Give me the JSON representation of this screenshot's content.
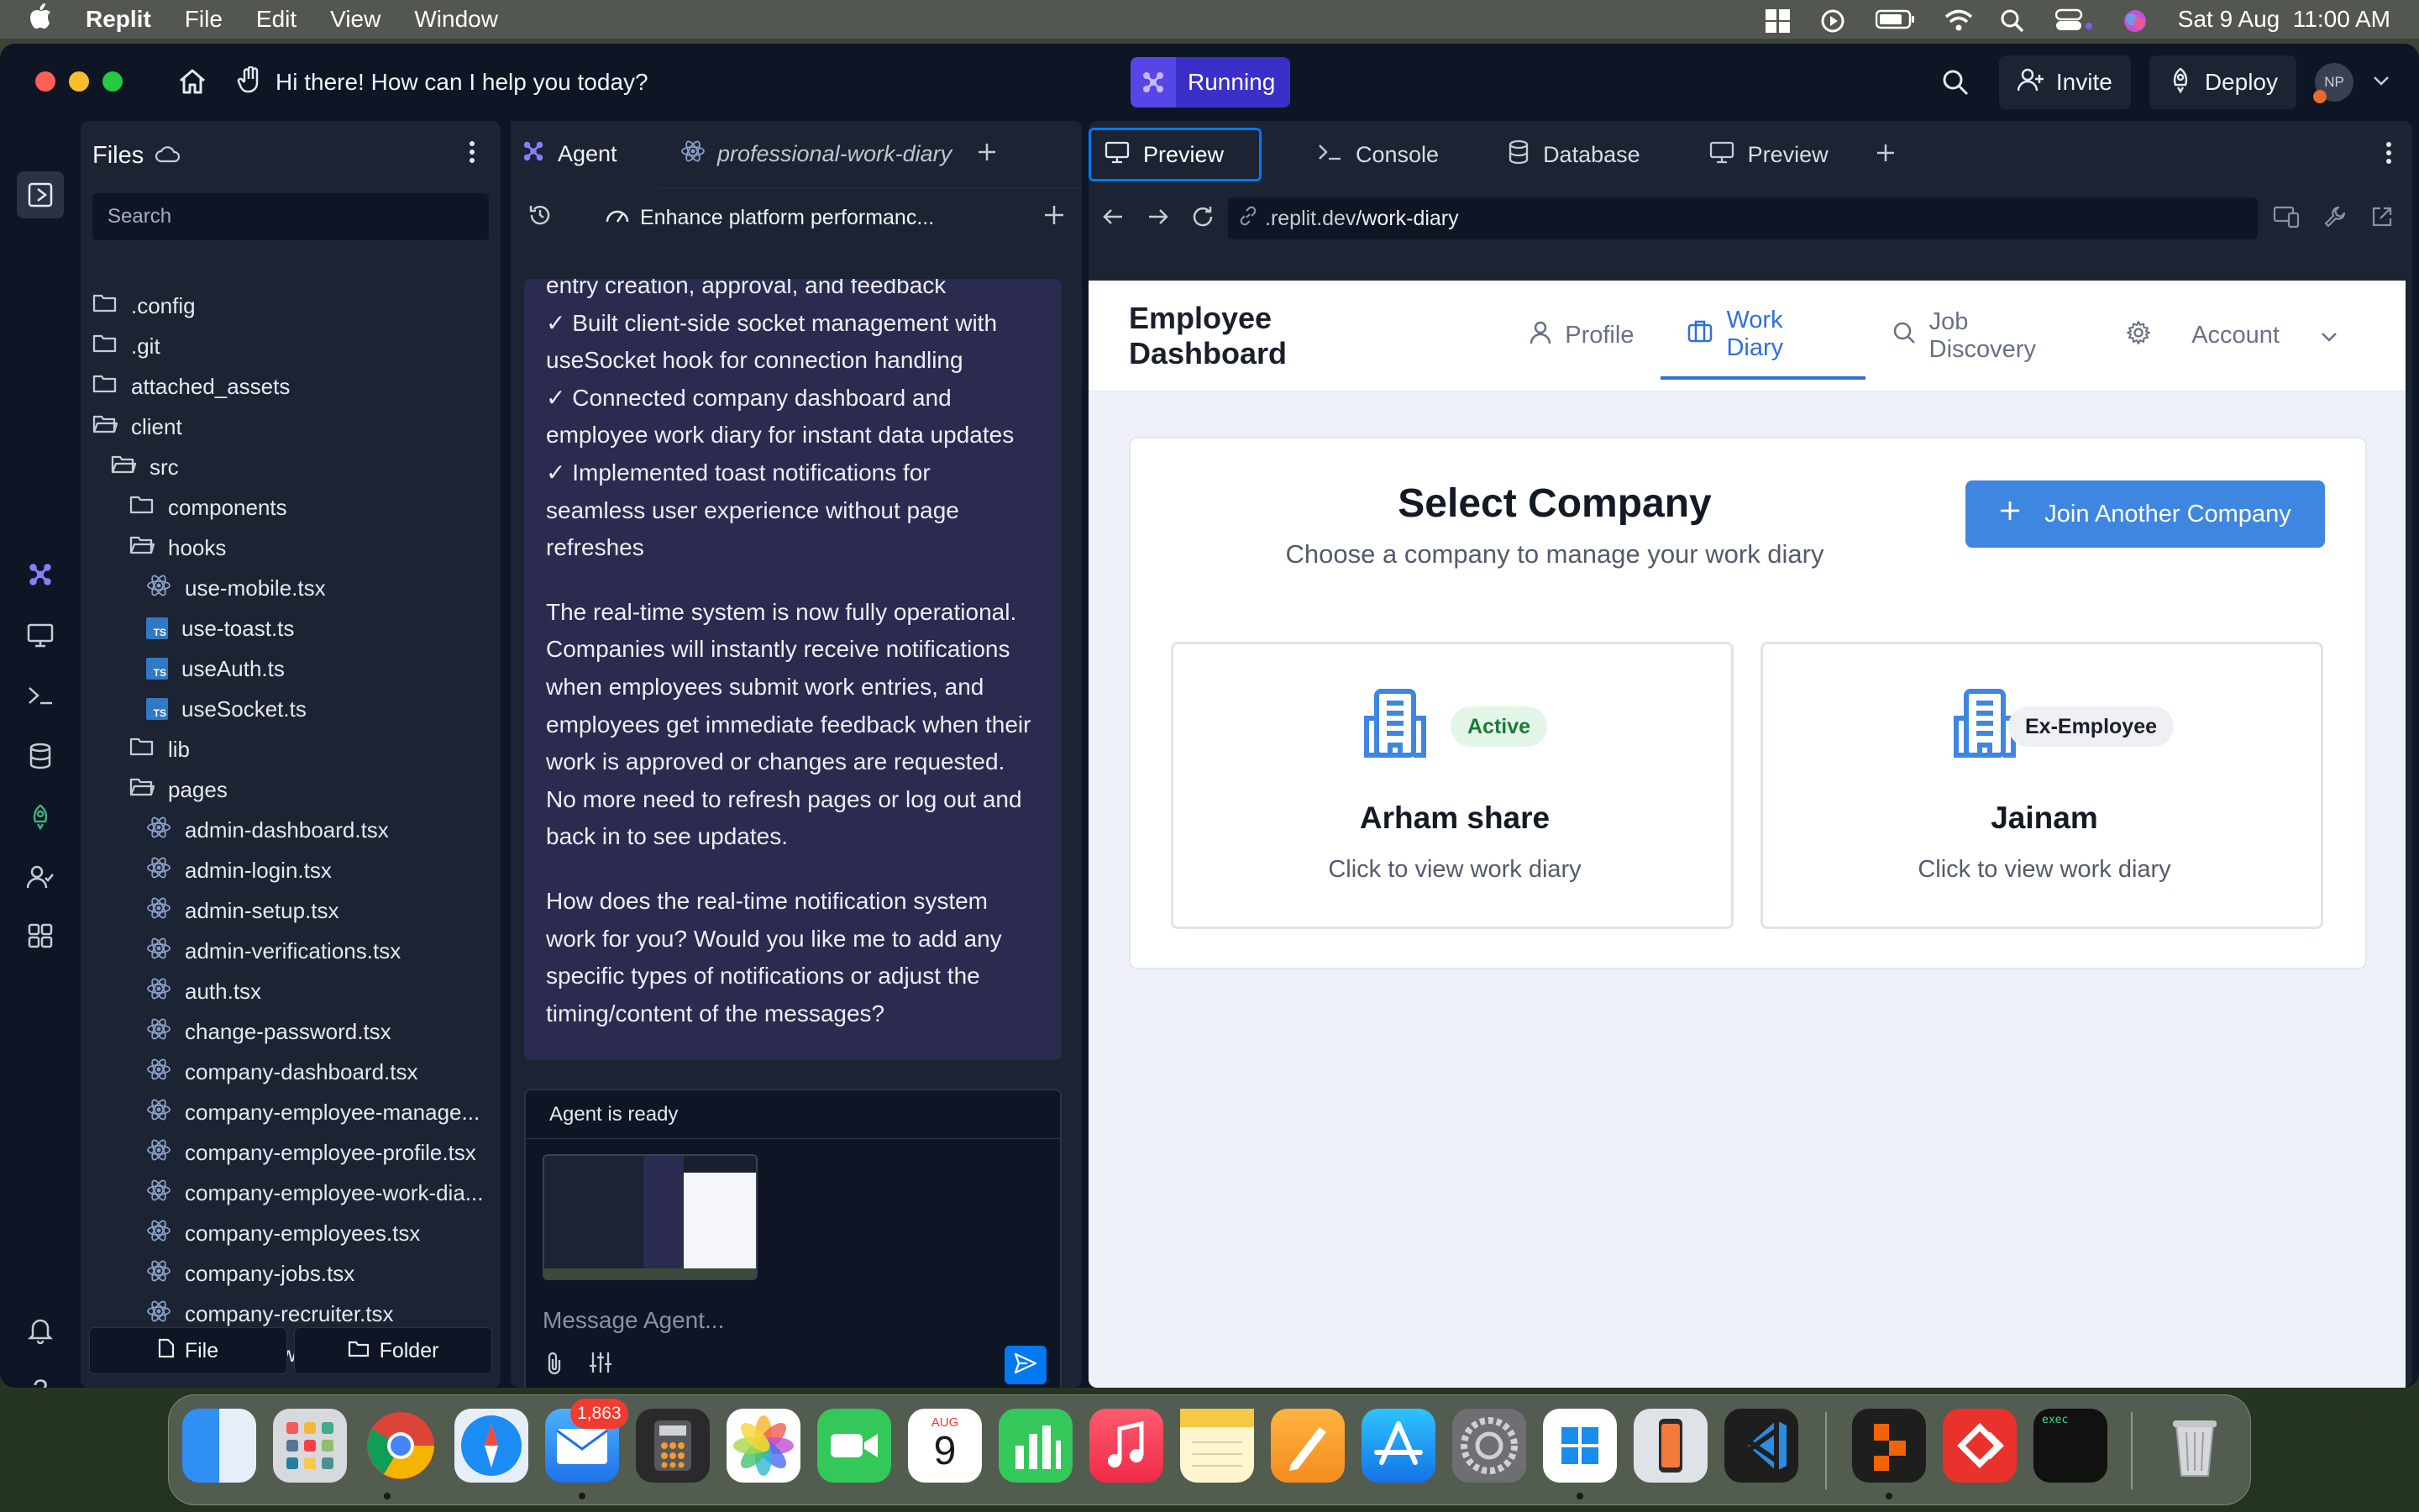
{
  "menubar": {
    "app_name": "Replit",
    "menus": [
      "File",
      "Edit",
      "View",
      "Window"
    ],
    "datetime": "Sat 9 Aug  11:00 AM"
  },
  "titlebar": {
    "agent_prompt": "Hi there! How can I help you today?",
    "run_status": "Running",
    "invite_label": "Invite",
    "deploy_label": "Deploy",
    "avatar_initials": "NP"
  },
  "files": {
    "title": "Files",
    "search_placeholder": "Search",
    "file_button": "File",
    "folder_button": "Folder",
    "tree": [
      {
        "label": ".config",
        "type": "folder",
        "depth": 0
      },
      {
        "label": ".git",
        "type": "folder",
        "depth": 0
      },
      {
        "label": "attached_assets",
        "type": "folder",
        "depth": 0
      },
      {
        "label": "client",
        "type": "folder-open",
        "depth": 0
      },
      {
        "label": "src",
        "type": "folder-open",
        "depth": 1
      },
      {
        "label": "components",
        "type": "folder",
        "depth": 2
      },
      {
        "label": "hooks",
        "type": "folder-open",
        "depth": 2
      },
      {
        "label": "use-mobile.tsx",
        "type": "react",
        "depth": 3
      },
      {
        "label": "use-toast.ts",
        "type": "ts",
        "depth": 3
      },
      {
        "label": "useAuth.ts",
        "type": "ts",
        "depth": 3
      },
      {
        "label": "useSocket.ts",
        "type": "ts",
        "depth": 3
      },
      {
        "label": "lib",
        "type": "folder",
        "depth": 2
      },
      {
        "label": "pages",
        "type": "folder-open",
        "depth": 2
      },
      {
        "label": "admin-dashboard.tsx",
        "type": "react",
        "depth": 3
      },
      {
        "label": "admin-login.tsx",
        "type": "react",
        "depth": 3
      },
      {
        "label": "admin-setup.tsx",
        "type": "react",
        "depth": 3
      },
      {
        "label": "admin-verifications.tsx",
        "type": "react",
        "depth": 3
      },
      {
        "label": "auth.tsx",
        "type": "react",
        "depth": 3
      },
      {
        "label": "change-password.tsx",
        "type": "react",
        "depth": 3
      },
      {
        "label": "company-dashboard.tsx",
        "type": "react",
        "depth": 3
      },
      {
        "label": "company-employee-manage...",
        "type": "react",
        "depth": 3
      },
      {
        "label": "company-employee-profile.tsx",
        "type": "react",
        "depth": 3
      },
      {
        "label": "company-employee-work-dia...",
        "type": "react",
        "depth": 3
      },
      {
        "label": "company-employees.tsx",
        "type": "react",
        "depth": 3
      },
      {
        "label": "company-jobs.tsx",
        "type": "react",
        "depth": 3
      },
      {
        "label": "company-recruiter.tsx",
        "type": "react",
        "depth": 3
      },
      {
        "label": "company-work-entries.tsx",
        "type": "react",
        "depth": 3
      }
    ]
  },
  "agent": {
    "tab_agent": "Agent",
    "tab_repl": "professional-work-diary",
    "subheader": "Enhance platform performanc...",
    "message_lines": [
      "entry creation, approval, and feedback",
      "✓ Built client-side socket management with",
      "useSocket hook for connection handling",
      "✓ Connected company dashboard and",
      "employee work diary for instant data updates",
      "✓ Implemented toast notifications for",
      "seamless user experience without page",
      "refreshes"
    ],
    "paragraph_2": "The real-time system is now fully operational. Companies will instantly receive notifications when employees submit work entries, and employees get immediate feedback when their work is approved or changes are requested. No more need to refresh pages or log out and back in to see updates.",
    "paragraph_3": "How does the real-time notification system work for you? Would you like me to add any specific types of notifications or adjust the timing/content of the messages?",
    "status": "Agent is ready",
    "input_placeholder": "Message Agent..."
  },
  "preview_tabs": [
    "Preview",
    "Console",
    "Database",
    "Preview"
  ],
  "url": {
    "host": ".replit.dev",
    "path": "/work-diary"
  },
  "app": {
    "title": "Employee Dashboard",
    "nav": [
      {
        "label": "Profile",
        "icon": "user-icon"
      },
      {
        "label": "Work Diary",
        "icon": "briefcase-icon"
      },
      {
        "label": "Job Discovery",
        "icon": "search-icon"
      },
      {
        "label": "Account",
        "icon": "gear-icon"
      }
    ],
    "select_title": "Select Company",
    "select_subtitle": "Choose a company to manage your work diary",
    "join_button": "Join Another Company",
    "companies": [
      {
        "name": "Arham share",
        "badge": "Active",
        "hint": "Click to view work diary"
      },
      {
        "name": "Jainam",
        "badge": "Ex-Employee",
        "hint": "Click to view work diary"
      }
    ]
  },
  "dock": {
    "mail_badge": "1,863",
    "calendar_month": "AUG",
    "calendar_day": "9"
  },
  "colors": {
    "accent_blue": "#0079f2",
    "run_purple": "#3b2fc9",
    "agent_message_bg": "#2b2a4f",
    "active_badge_bg": "#e3f6e8",
    "active_badge_text": "#1f7a3a",
    "ex_badge_bg": "#eef0f3",
    "brand_blue": "#3f86e0"
  }
}
